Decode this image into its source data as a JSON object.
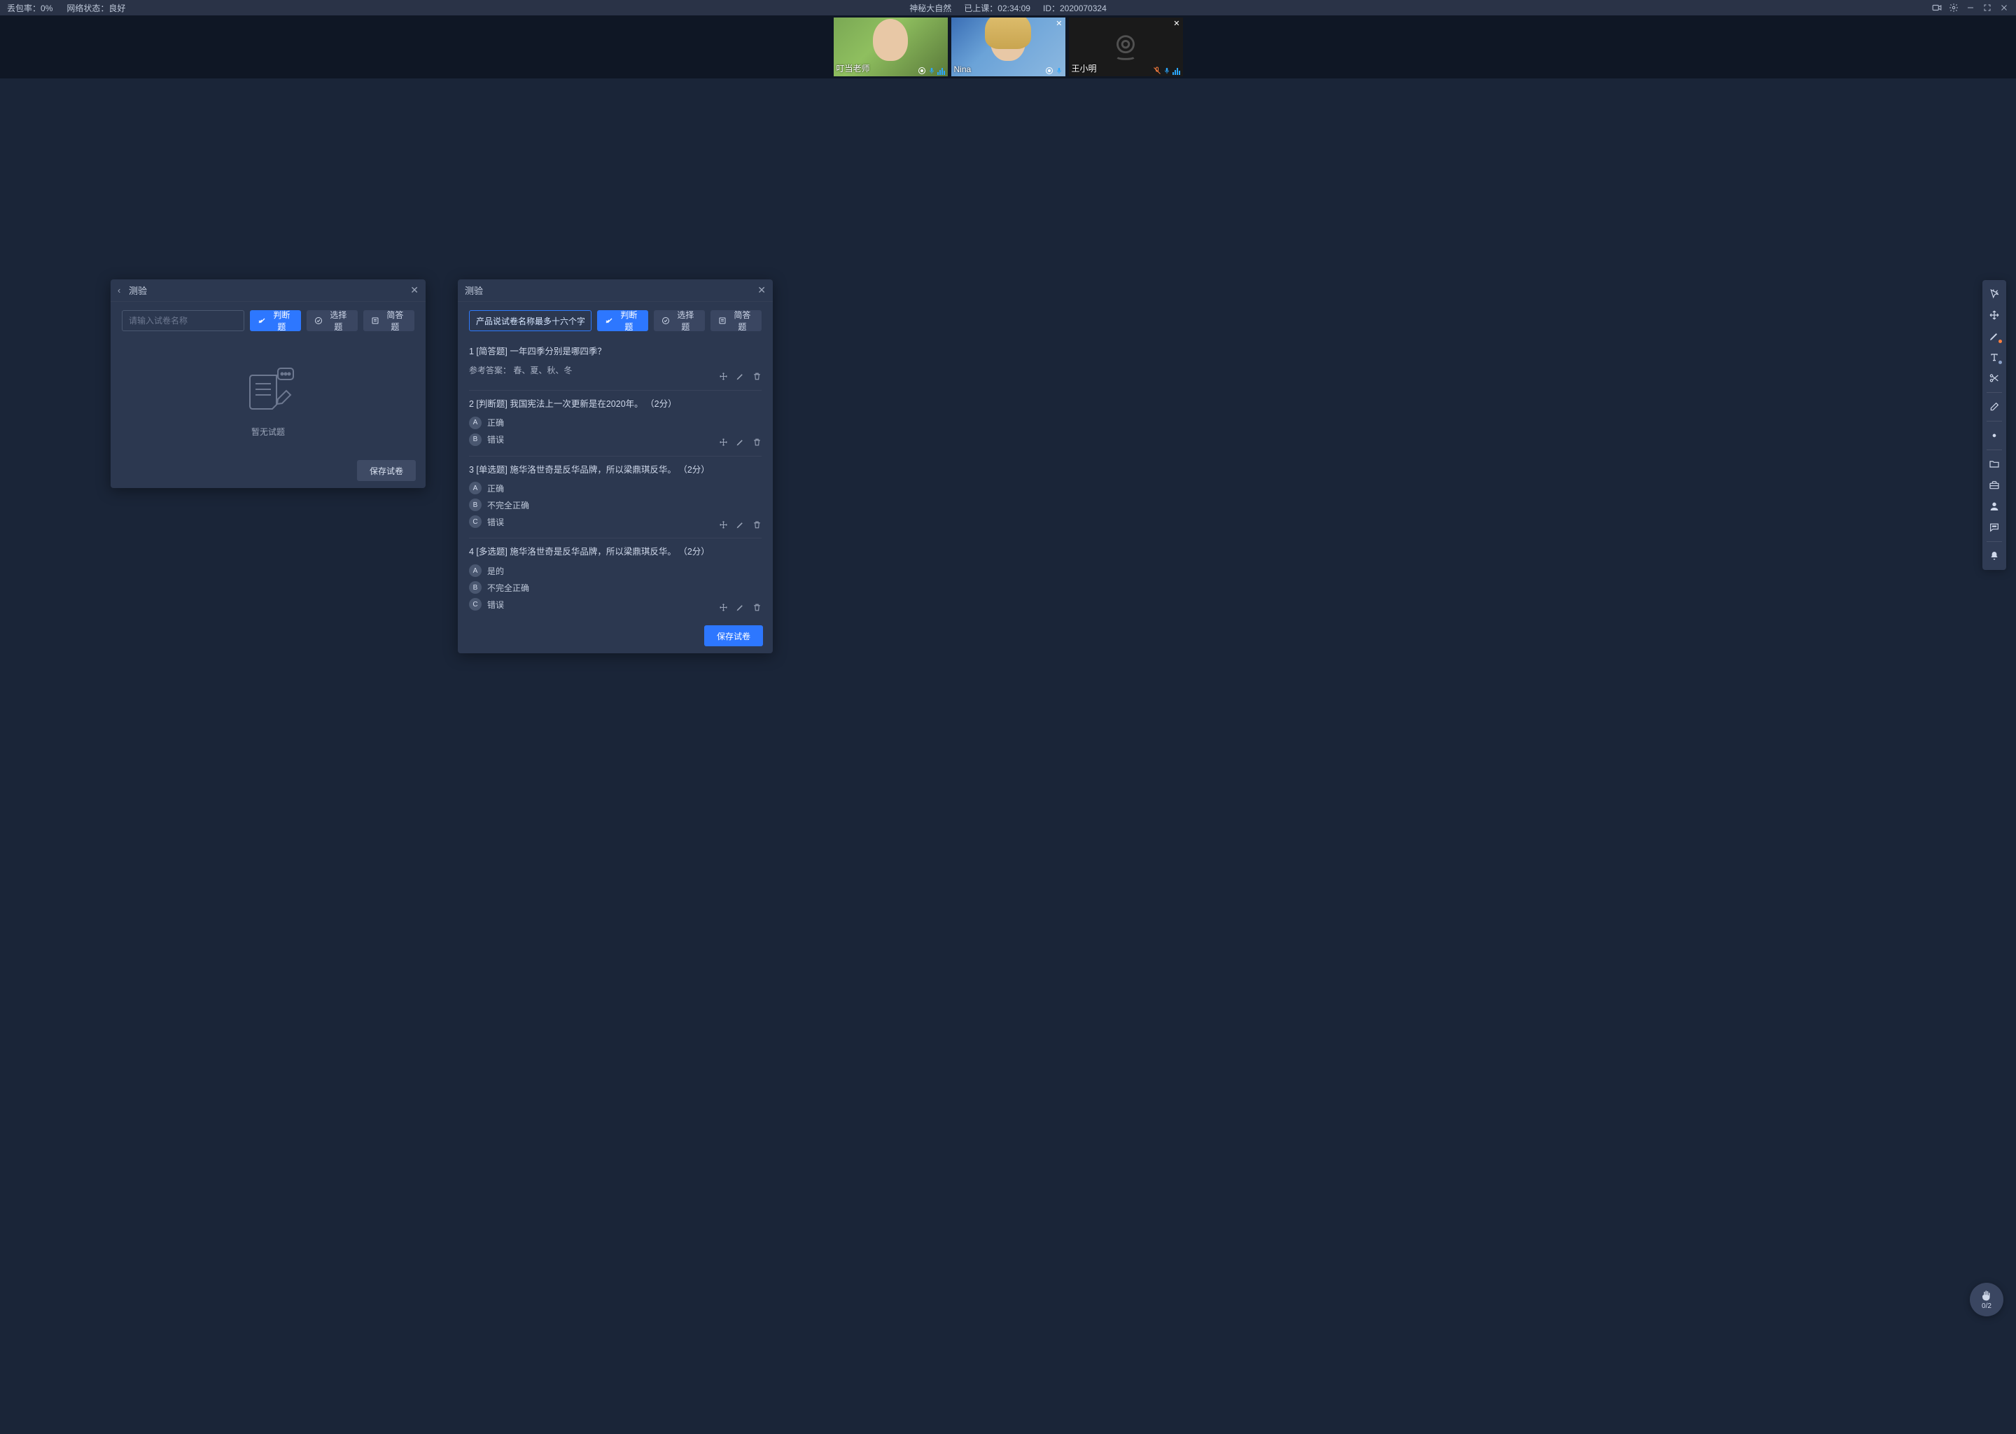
{
  "top": {
    "loss_label": "丢包率：",
    "loss_value": "0%",
    "net_label": "网络状态：",
    "net_value": "良好",
    "course_name": "神秘大自然",
    "elapsed_label": "已上课：",
    "elapsed_value": "02:34:09",
    "id_label": "ID：",
    "id_value": "2020070324"
  },
  "participants": [
    {
      "name": "叮当老师",
      "kind": "green",
      "closable": false,
      "mic": "on"
    },
    {
      "name": "Nina",
      "kind": "sea",
      "closable": true,
      "mic": "on"
    },
    {
      "name": "王小明",
      "kind": "black",
      "closable": true,
      "mic": "muted"
    }
  ],
  "panel_left": {
    "title": "测验",
    "name_placeholder": "请输入试卷名称",
    "name_value": "",
    "types": {
      "tf": "判断题",
      "choice": "选择题",
      "short": "简答题"
    },
    "empty_text": "暂无试题",
    "save_label": "保存试卷"
  },
  "panel_right": {
    "title": "测验",
    "name_value": "产品说试卷名称最多十六个字",
    "types": {
      "tf": "判断题",
      "choice": "选择题",
      "short": "简答题"
    },
    "save_label": "保存试卷",
    "ref_answer_label": "参考答案：",
    "questions": [
      {
        "num": "1",
        "tag": "[简答题]",
        "text": "一年四季分别是哪四季？",
        "ref": "春、夏、秋、冬",
        "options": []
      },
      {
        "num": "2",
        "tag": "[判断题]",
        "text": "我国宪法上一次更新是在2020年。",
        "points": "（2分）",
        "options": [
          {
            "letter": "A",
            "text": "正确"
          },
          {
            "letter": "B",
            "text": "错误"
          }
        ]
      },
      {
        "num": "3",
        "tag": "[单选题]",
        "text": "施华洛世奇是反华品牌，所以梁鼎琪反华。",
        "points": "（2分）",
        "options": [
          {
            "letter": "A",
            "text": "正确"
          },
          {
            "letter": "B",
            "text": "不完全正确"
          },
          {
            "letter": "C",
            "text": "错误"
          }
        ]
      },
      {
        "num": "4",
        "tag": "[多选题]",
        "text": "施华洛世奇是反华品牌，所以梁鼎琪反华。",
        "points": "（2分）",
        "options": [
          {
            "letter": "A",
            "text": "是的"
          },
          {
            "letter": "B",
            "text": "不完全正确"
          },
          {
            "letter": "C",
            "text": "错误"
          }
        ]
      }
    ]
  },
  "hand": {
    "count": "0/2"
  },
  "colors": {
    "accent": "#2d77ff",
    "orange": "#ff7f3f"
  }
}
